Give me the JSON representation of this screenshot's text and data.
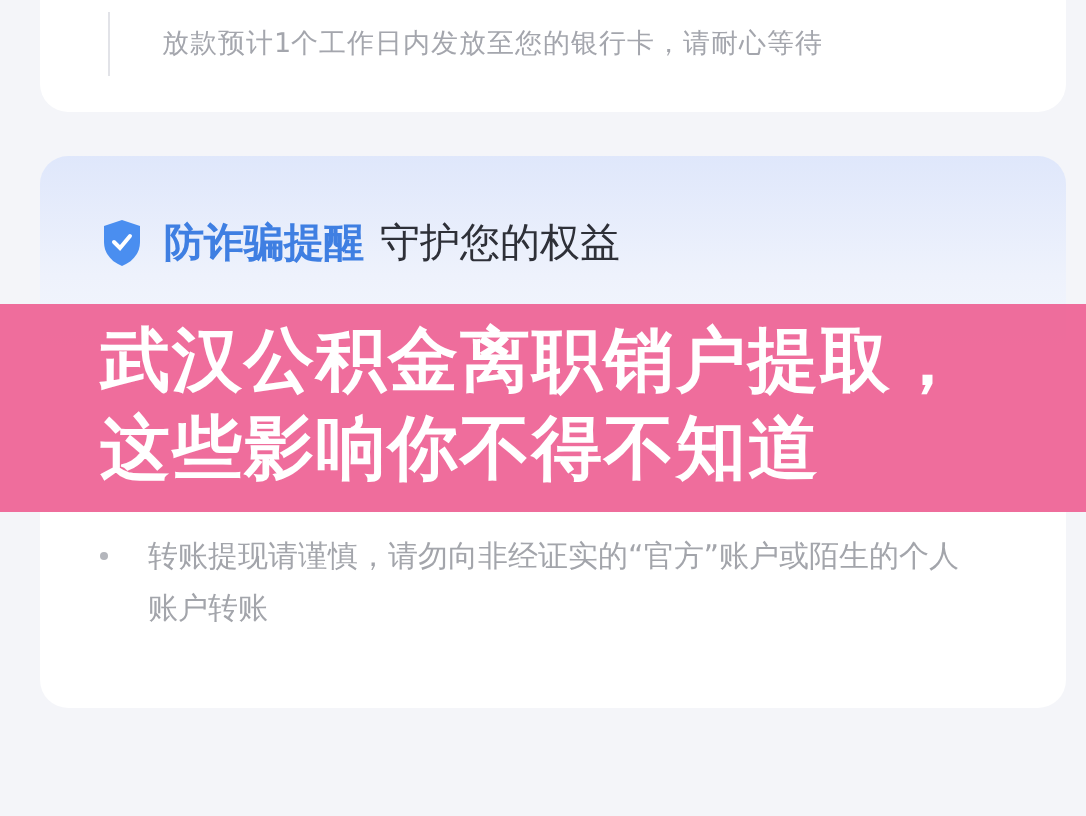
{
  "notice": {
    "text": "放款预计1个工作日内发放至您的银行卡，请耐心等待"
  },
  "safety": {
    "title_highlight": "防诈骗提醒",
    "title_rest": "守护您的权益",
    "tips": [
      {
        "text": "转账提现请谨慎，请勿向非经证实的“官方”账户或陌生的个人账户转账"
      }
    ]
  },
  "banner": {
    "headline": "武汉公积金离职销户提取，这些影响你不得不知道"
  }
}
